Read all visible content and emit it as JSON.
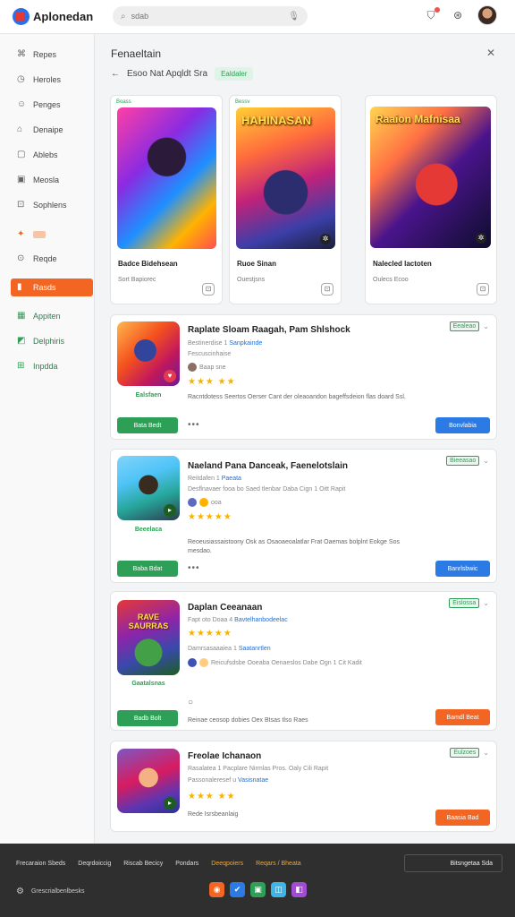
{
  "topbar": {
    "app_name": "Aplonedan",
    "search_placeholder": "sdab",
    "icons": [
      "cart-icon",
      "help-icon",
      "avatar"
    ]
  },
  "sidebar": {
    "items": [
      {
        "label": "Repes",
        "icon": "gamepad-icon"
      },
      {
        "label": "Heroles",
        "icon": "clock-icon"
      },
      {
        "label": "Penges",
        "icon": "smile-icon"
      },
      {
        "label": "Denaipe",
        "icon": "bookmark-icon"
      },
      {
        "label": "Ablebs",
        "icon": "square-icon"
      },
      {
        "label": "Meosla",
        "icon": "image-icon"
      },
      {
        "label": "Sophlens",
        "icon": "tag-icon"
      },
      {
        "label": "",
        "icon": "pin-icon"
      },
      {
        "label": "Reqde",
        "icon": "compass-icon"
      },
      {
        "label": "Rasds",
        "icon": "flag-icon"
      },
      {
        "label": "Appiten",
        "icon": "chart-icon"
      },
      {
        "label": "Delphiris",
        "icon": "trend-icon"
      },
      {
        "label": "Inpdda",
        "icon": "grid-icon"
      }
    ]
  },
  "main": {
    "title": "Fenaeltain",
    "breadcrumb": {
      "back": "←",
      "text": "Esoo Nat Apqldt Sra",
      "tag": "Ealdaler"
    },
    "featured": [
      {
        "badge": "Boass",
        "art_title": "HAHINASAN",
        "title": "Badce Bidehsean",
        "sub": "Sort Bapiorec"
      },
      {
        "badge": "Bessv",
        "art_title": "HAHINASAN",
        "title": "Ruoe Sinan",
        "sub": "Ouestjsns"
      },
      {
        "badge": "",
        "art_title": "Raaion Mafnisaa",
        "title": "Nalecled lactoten",
        "sub": "Oulecs Ecoo"
      }
    ],
    "cards": [
      {
        "icon_text": "",
        "developer": "Ealsfaen",
        "title": "Raplate Sloam Raagah, Pam Shlshock",
        "meta1": "Bestinerdise 1 ",
        "meta1_link": "Sanpkainde",
        "meta2": "Fescuscinhaise",
        "meta3": "Baap sne",
        "stars": "★★★ ★★",
        "desc": "Racntdotess Seertos Oerser Cant der oleaoandon bageffsdeion flas doard Ssl.",
        "rating": "Eealeao",
        "left_btn": "Bata Bedt",
        "right_btn": "Bonvlabia"
      },
      {
        "icon_text": "",
        "developer": "Beeelaca",
        "title": "Naeland Pana Danceak, Faenelotslain",
        "meta1": "Reitdafen 1 ",
        "meta1_link": "Paeata",
        "meta2": "Desflnavaer fooa bo Saed tlenbar Daba Cign 1 Oitt Rapit",
        "meta3": "ooa",
        "stars": "★★★★★",
        "desc": "Reoeusiassaistoony Osk as Osaoaeoalatlar Frat Oaemas bolplnt Eokge Sos mesdao.",
        "rating": "Bieeasao",
        "left_btn": "Baba Bdat",
        "right_btn": "Banrlsbwic"
      },
      {
        "icon_text": "RAVE SAURRAS",
        "developer": "Gaatalsnas",
        "title": "Daplan Ceeanaan",
        "meta1": "Fapt oto Doaa 4 ",
        "meta1_link": "Bavtelhanbodeelac",
        "meta2": "Damrsasaaaiea 1 ",
        "meta2_link": "Saatanrtlen",
        "meta3": "Reicufsdsbe Ooeaba Oenaeslos Dabe Ogn 1 Cit Kadit",
        "stars": "★★★★★",
        "desc": "Reinae ceosop dobies Oex Btsas tlso Raes",
        "rating": "Eislossa",
        "left_btn": "Badb Bolt",
        "right_btn": "Bamdl Beat"
      },
      {
        "icon_text": "",
        "developer": "",
        "title": "Freolae Ichanaon",
        "meta1": "Rasalatea 1 Pacplare Nirmlas Pros. Oaly Cili Rapit",
        "meta2": "Passonaleresef u ",
        "meta2_link": "Vasisnatae",
        "stars": "★★★ ★★",
        "desc": "Rede Isrsbeanlaig",
        "rating": "Eulzoes",
        "left_btn": "",
        "right_btn": "Baasia Bad"
      }
    ]
  },
  "footer": {
    "links": [
      "Frecaraion Sbeds",
      "Deqrdoiccig",
      "Riscab Becicy",
      "Pondars",
      "Deeqpoiers",
      "Reqars / Bheata"
    ],
    "select": "Bitsngetaa Sda",
    "copyright": "Grescrialbenlbesks",
    "social_colors": [
      "#f26522",
      "#2c7be5",
      "#2e9f57",
      "#3db5e6",
      "#a24bd6"
    ]
  }
}
